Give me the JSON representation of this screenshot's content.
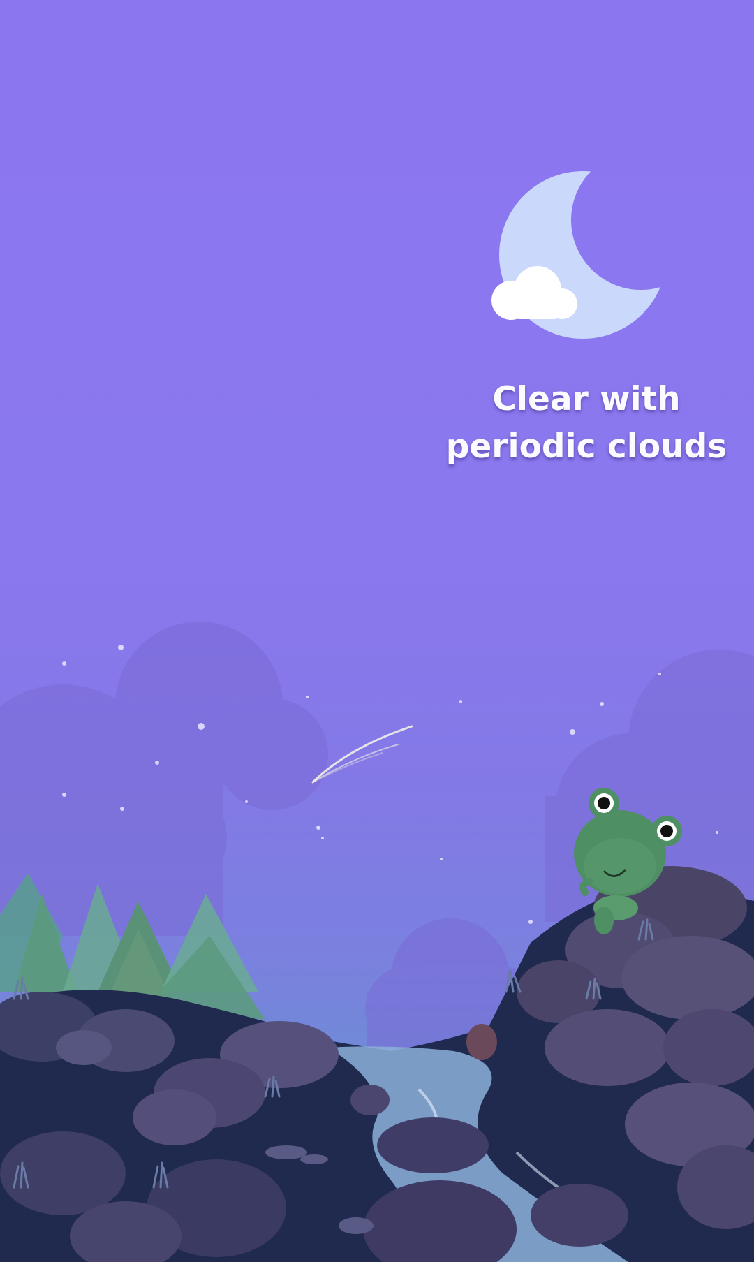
{
  "weather": {
    "condition_line1": "Clear with",
    "condition_line2": "periodic clouds",
    "icon": "moon-with-cloud-icon"
  },
  "illustration": {
    "scene": "night-landscape-illustration",
    "character": "frog-mascot"
  },
  "colors": {
    "sky_top": "#8c76f0",
    "sky_bottom": "#5c7ec8",
    "moon": "#c9d8fb",
    "cloud": "#ffffff",
    "text": "#fbfbff",
    "frog": "#4e8f64"
  }
}
